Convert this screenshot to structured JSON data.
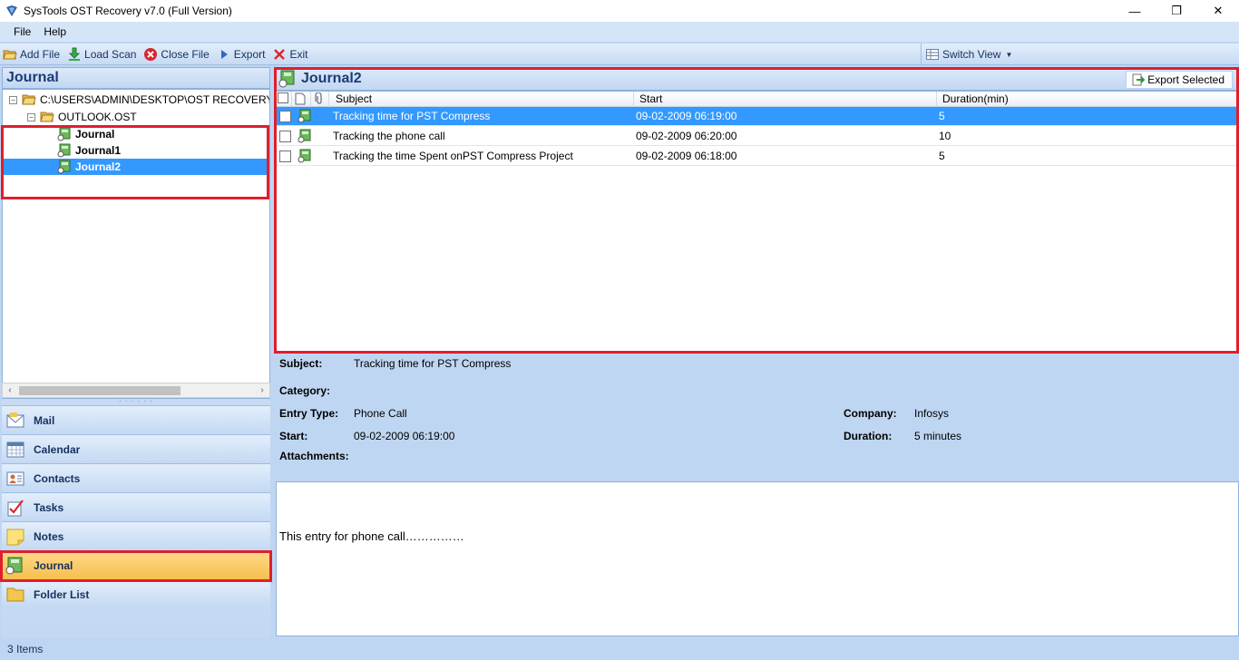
{
  "window": {
    "title": "SysTools OST Recovery v7.0 (Full Version)",
    "minimize": "—",
    "maximize": "❐",
    "close": "✕"
  },
  "menu": {
    "items": [
      "File",
      "Help"
    ]
  },
  "toolbar": {
    "add_file": "Add File",
    "load_scan": "Load Scan",
    "close_file": "Close File",
    "export": "Export",
    "exit": "Exit",
    "switch_view": "Switch View"
  },
  "left": {
    "header": "Journal",
    "tree": {
      "root": "C:\\USERS\\ADMIN\\DESKTOP\\OST RECOVERY\\OU",
      "file": "OUTLOOK.OST",
      "folders": [
        "Journal",
        "Journal1",
        "Journal2"
      ],
      "selected_folder": "Journal2"
    },
    "nav": [
      "Mail",
      "Calendar",
      "Contacts",
      "Tasks",
      "Notes",
      "Journal",
      "Folder List"
    ],
    "active_nav": "Journal"
  },
  "list": {
    "title": "Journal2",
    "export_selected": "Export Selected",
    "columns": {
      "subject": "Subject",
      "start": "Start",
      "duration": "Duration(min)"
    },
    "rows": [
      {
        "subject": "Tracking time for PST Compress",
        "start": "09-02-2009 06:19:00",
        "duration": "5"
      },
      {
        "subject": "Tracking the phone call",
        "start": "09-02-2009 06:20:00",
        "duration": "10"
      },
      {
        "subject": "Tracking the time Spent onPST Compress  Project",
        "start": "09-02-2009 06:18:00",
        "duration": "5"
      }
    ]
  },
  "details": {
    "subject_label": "Subject:",
    "subject": "Tracking time for PST Compress",
    "category_label": "Category:",
    "category": "",
    "entry_type_label": "Entry Type:",
    "entry_type": "Phone Call",
    "company_label": "Company:",
    "company": "Infosys",
    "start_label": "Start:",
    "start": "09-02-2009 06:19:00",
    "duration_label": "Duration:",
    "duration": "5 minutes",
    "attachments_label": "Attachments:",
    "body": "This entry for phone call……………"
  },
  "status": {
    "text": "3 Items"
  },
  "colors": {
    "accent": "#3399ff",
    "highlight": "#e01e2c",
    "active_nav": "#f7be4c"
  }
}
